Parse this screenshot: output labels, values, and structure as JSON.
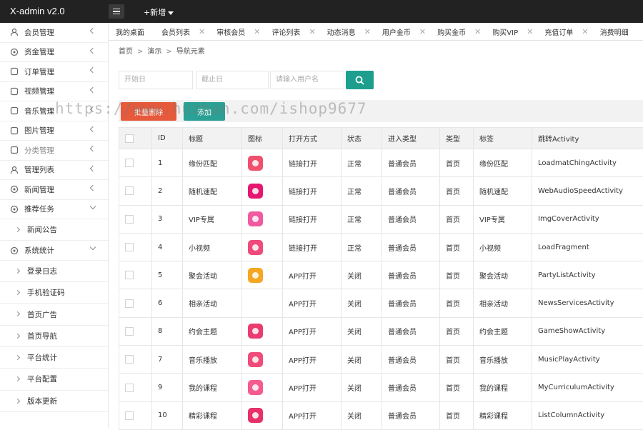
{
  "app": {
    "title": "X-admin v2.0",
    "add_new": "+新增"
  },
  "sidebar": {
    "items": [
      {
        "label": "会员管理",
        "icon": "user-icon"
      },
      {
        "label": "资金管理",
        "icon": "money-icon"
      },
      {
        "label": "订单管理",
        "icon": "order-icon"
      },
      {
        "label": "视频管理",
        "icon": "video-icon"
      },
      {
        "label": "音乐管理",
        "icon": "music-icon"
      },
      {
        "label": "图片管理",
        "icon": "image-icon"
      },
      {
        "label": "分类管理",
        "icon": "category-icon"
      },
      {
        "label": "管理列表",
        "icon": "admin-icon"
      },
      {
        "label": "新闻管理",
        "icon": "news-icon"
      },
      {
        "label": "推荐任务",
        "icon": "task-icon"
      }
    ],
    "task_sub": [
      "新闻公告"
    ],
    "stats_label": "系统统计",
    "stats_sub": [
      "登录日志",
      "手机验证码",
      "首页广告",
      "首页导航",
      "平台统计",
      "平台配置",
      "版本更新"
    ]
  },
  "tabs": [
    "我的桌面",
    "会员列表",
    "审核会员",
    "评论列表",
    "动态消息",
    "用户金币",
    "购买金币",
    "购买VIP",
    "充值订单",
    "消费明细"
  ],
  "breadcrumb": [
    "首页",
    "演示",
    "导航元素"
  ],
  "search": {
    "start_placeholder": "开始日",
    "end_placeholder": "截止日",
    "user_placeholder": "请输入用户名"
  },
  "buttons": {
    "batch_delete": "批量删除",
    "add": "添加"
  },
  "watermark": "https://www.huzhan.com/ishop9677",
  "table": {
    "headers": [
      "",
      "ID",
      "标题",
      "图标",
      "打开方式",
      "状态",
      "进入类型",
      "类型",
      "标签",
      "跳转Activity"
    ],
    "rows": [
      {
        "id": "1",
        "title": "缘份匹配",
        "icon_color": "#f0506e",
        "open": "链接打开",
        "status": "正常",
        "enter": "普通会员",
        "type": "首页",
        "tag": "缘份匹配",
        "activity": "LoadmatChingActivity",
        "closed": false
      },
      {
        "id": "2",
        "title": "随机速配",
        "icon_color": "#e6176e",
        "open": "链接打开",
        "status": "正常",
        "enter": "普通会员",
        "type": "首页",
        "tag": "随机速配",
        "activity": "WebAudioSpeedActivity",
        "closed": false
      },
      {
        "id": "3",
        "title": "VIP专属",
        "icon_color": "#f05aa0",
        "open": "链接打开",
        "status": "正常",
        "enter": "普通会员",
        "type": "首页",
        "tag": "VIP专属",
        "activity": "ImgCoverActivity",
        "closed": false
      },
      {
        "id": "4",
        "title": "小视频",
        "icon_color": "#ef4b7a",
        "open": "链接打开",
        "status": "正常",
        "enter": "普通会员",
        "type": "首页",
        "tag": "小视频",
        "activity": "LoadFragment",
        "closed": false
      },
      {
        "id": "5",
        "title": "聚会活动",
        "icon_color": "#f5a623",
        "open": "APP打开",
        "status": "关闭",
        "enter": "普通会员",
        "type": "首页",
        "tag": "聚会活动",
        "activity": "PartyListActivity",
        "closed": true
      },
      {
        "id": "6",
        "title": "相亲活动",
        "icon_color": "",
        "open": "APP打开",
        "status": "关闭",
        "enter": "普通会员",
        "type": "首页",
        "tag": "相亲活动",
        "activity": "NewsServicesActivity",
        "closed": true
      },
      {
        "id": "8",
        "title": "约会主题",
        "icon_color": "#ea3c70",
        "open": "APP打开",
        "status": "关闭",
        "enter": "普通会员",
        "type": "首页",
        "tag": "约会主题",
        "activity": "GameShowActivity",
        "closed": true
      },
      {
        "id": "7",
        "title": "音乐播放",
        "icon_color": "#f04c7a",
        "open": "APP打开",
        "status": "关闭",
        "enter": "普通会员",
        "type": "首页",
        "tag": "音乐播放",
        "activity": "MusicPlayActivity",
        "closed": true
      },
      {
        "id": "9",
        "title": "我的课程",
        "icon_color": "#f45b8e",
        "open": "APP打开",
        "status": "关闭",
        "enter": "普通会员",
        "type": "首页",
        "tag": "我的课程",
        "activity": "MyCurriculumActivity",
        "closed": true
      },
      {
        "id": "10",
        "title": "精彩课程",
        "icon_color": "#e8306a",
        "open": "APP打开",
        "status": "关闭",
        "enter": "普通会员",
        "type": "首页",
        "tag": "精彩课程",
        "activity": "ListColumnActivity",
        "closed": true
      }
    ]
  }
}
